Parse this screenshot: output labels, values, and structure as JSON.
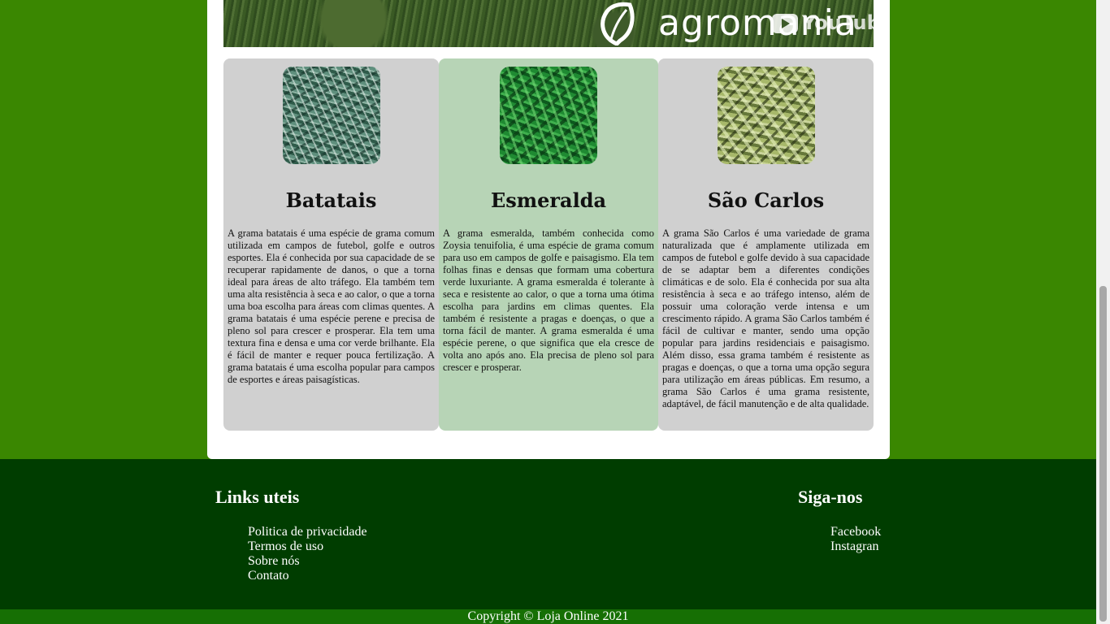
{
  "banner": {
    "brand": "agromania",
    "video_label": "YouTube"
  },
  "cards": [
    {
      "title": "Batatais",
      "text": "A grama batatais é uma espécie de grama comum utilizada em campos de futebol, golfe e outros esportes. Ela é conhecida por sua capacidade de se recuperar rapidamente de danos, o que a torna ideal para áreas de alto tráfego. Ela também tem uma alta resistência à seca e ao calor, o que a torna uma boa escolha para áreas com climas quentes. A grama batatais é uma espécie perene e precisa de pleno sol para crescer e prosperar. Ela tem uma textura fina e densa e uma cor verde brilhante. Ela é fácil de manter e requer pouca fertilização. A grama batatais é uma escolha popular para campos de esportes e áreas paisagísticas."
    },
    {
      "title": "Esmeralda",
      "text": "A grama esmeralda, também conhecida como Zoysia tenuifolia, é uma espécie de grama comum para uso em campos de golfe e paisagismo. Ela tem folhas finas e densas que formam uma cobertura verde luxuriante. A grama esmeralda é tolerante à seca e resistente ao calor, o que a torna uma ótima escolha para jardins em climas quentes. Ela também é resistente a pragas e doenças, o que a torna fácil de manter. A grama esmeralda é uma espécie perene, o que significa que ela cresce de volta ano após ano. Ela precisa de pleno sol para crescer e prosperar."
    },
    {
      "title": "São Carlos",
      "text": "A grama São Carlos é uma variedade de grama naturalizada que é amplamente utilizada em campos de futebol e golfe devido à sua capacidade de se adaptar bem a diferentes condições climáticas e de solo. Ela é conhecida por sua alta resistência à seca e ao tráfego intenso, além de possuir uma coloração verde intensa e um crescimento rápido. A grama São Carlos também é fácil de cultivar e manter, sendo uma opção popular para jardins residenciais e paisagismo. Além disso, essa grama também é resistente as pragas e doenças, o que a torna uma opção segura para utilização em áreas públicas. Em resumo, a grama São Carlos é uma grama resistente, adaptável, de fácil manutenção e de alta qualidade."
    }
  ],
  "footer": {
    "links_title": "Links uteis",
    "links": [
      "Politica de privacidade",
      "Termos de uso",
      "Sobre nós",
      "Contato"
    ],
    "follow_title": "Siga-nos",
    "social": [
      "Facebook",
      "Instagran"
    ]
  },
  "copyright": "Copyright © Loja Online 2021",
  "colors": {
    "page_background": "#3a8701",
    "footer_background": "#003d00",
    "copyright_background": "#166f04",
    "card_gray": "#d0d0d0",
    "card_highlight": "#b7d4b6"
  }
}
